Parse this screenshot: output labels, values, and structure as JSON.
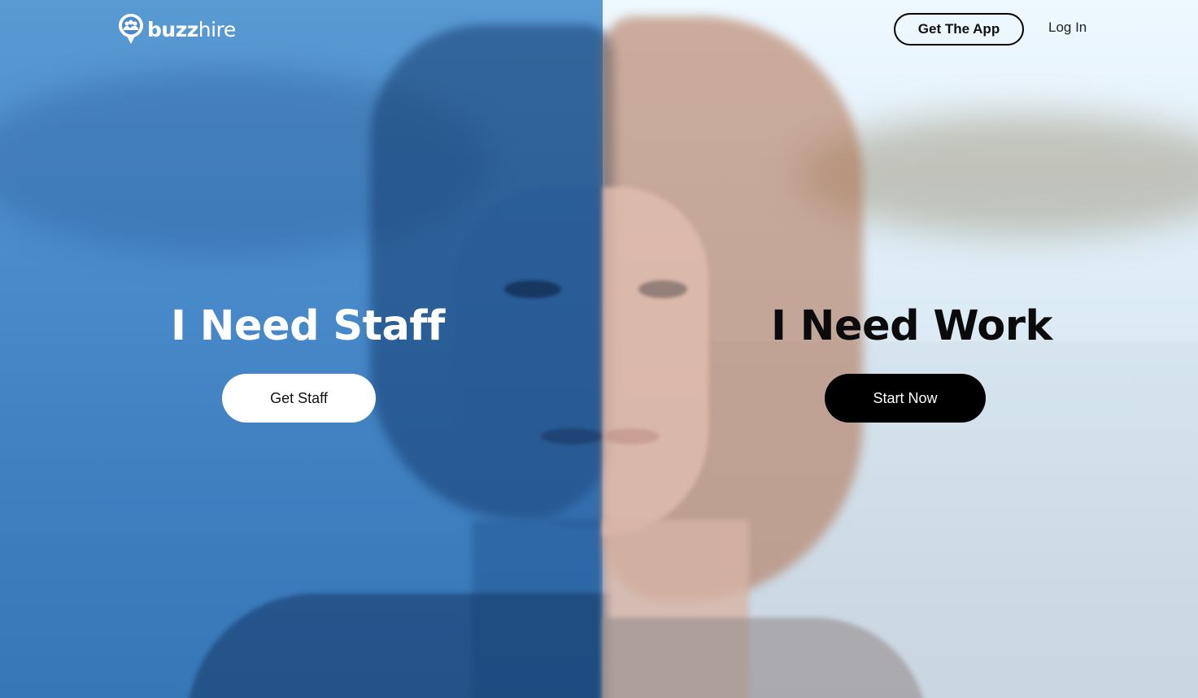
{
  "brand": {
    "name_bold": "buzz",
    "name_regular": "hire"
  },
  "header": {
    "get_app_label": "Get The App",
    "login_label": "Log In"
  },
  "left_panel": {
    "headline": "I Need Staff",
    "cta_label": "Get Staff",
    "tint_color": "#4a8acb"
  },
  "right_panel": {
    "headline": "I Need Work",
    "cta_label": "Start Now",
    "tint_color": "#e6f2fa"
  },
  "icons": [
    "buzzhire-logo-icon"
  ]
}
